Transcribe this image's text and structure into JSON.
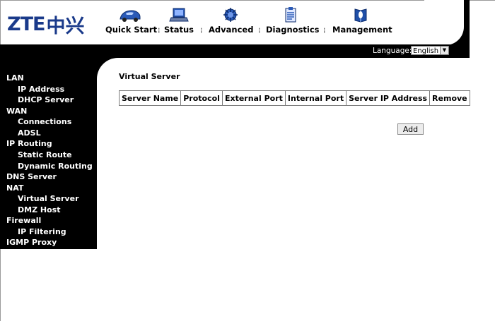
{
  "brand": {
    "logo_latin": "ZTE",
    "logo_cn": "中兴"
  },
  "nav": {
    "items": [
      {
        "label": "Quick Start",
        "icon": "car-icon"
      },
      {
        "label": "Status",
        "icon": "laptop-icon"
      },
      {
        "label": "Advanced",
        "icon": "chip-icon"
      },
      {
        "label": "Diagnostics",
        "icon": "clipboard-icon"
      },
      {
        "label": "Management",
        "icon": "book-icon"
      }
    ],
    "separator": "⁞"
  },
  "language": {
    "label": "Language:",
    "selected": "English"
  },
  "sidebar": {
    "items": [
      {
        "label": "LAN",
        "level": 0
      },
      {
        "label": "IP Address",
        "level": 1
      },
      {
        "label": "DHCP Server",
        "level": 1
      },
      {
        "label": "WAN",
        "level": 0
      },
      {
        "label": "Connections",
        "level": 1
      },
      {
        "label": "ADSL",
        "level": 1
      },
      {
        "label": "IP Routing",
        "level": 0
      },
      {
        "label": "Static Route",
        "level": 1
      },
      {
        "label": "Dynamic Routing",
        "level": 1
      },
      {
        "label": "DNS Server",
        "level": 0
      },
      {
        "label": "NAT",
        "level": 0
      },
      {
        "label": "Virtual Server",
        "level": 1
      },
      {
        "label": "DMZ Host",
        "level": 1
      },
      {
        "label": "Firewall",
        "level": 0
      },
      {
        "label": "IP Filtering",
        "level": 1
      },
      {
        "label": "IGMP Proxy",
        "level": 0
      }
    ]
  },
  "main": {
    "title": "Virtual Server",
    "table": {
      "headers": [
        "Server Name",
        "Protocol",
        "External Port",
        "Internal Port",
        "Server IP Address",
        "Remove"
      ],
      "rows": []
    },
    "add_label": "Add"
  },
  "colors": {
    "logo": "#1a3a8a",
    "band": "#000000",
    "nav_icon_blue": "#1f4fa8"
  }
}
